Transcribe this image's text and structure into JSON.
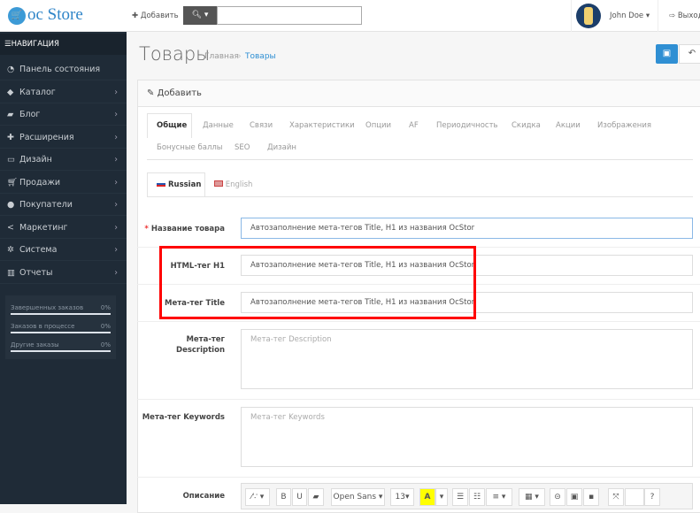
{
  "header": {
    "logo_text": "oc Store",
    "add_label": "Добавить",
    "search_placeholder": "",
    "user_name": "John Doe",
    "logout_label": "Выход"
  },
  "sidebar": {
    "nav_title": "НАВИГАЦИЯ",
    "items": [
      {
        "label": "Панель состояния",
        "icon": "dashboard-icon",
        "arrow": false
      },
      {
        "label": "Каталог",
        "icon": "tag-icon",
        "arrow": true
      },
      {
        "label": "Блог",
        "icon": "book-icon",
        "arrow": true
      },
      {
        "label": "Расширения",
        "icon": "puzzle-icon",
        "arrow": true
      },
      {
        "label": "Дизайн",
        "icon": "monitor-icon",
        "arrow": true
      },
      {
        "label": "Продажи",
        "icon": "cart-icon",
        "arrow": true
      },
      {
        "label": "Покупатели",
        "icon": "user-icon",
        "arrow": true
      },
      {
        "label": "Маркетинг",
        "icon": "share-icon",
        "arrow": true
      },
      {
        "label": "Система",
        "icon": "gear-icon",
        "arrow": true
      },
      {
        "label": "Отчеты",
        "icon": "bar-chart-icon",
        "arrow": true
      }
    ],
    "stats": [
      {
        "label": "Завершенных заказов",
        "value": "0%"
      },
      {
        "label": "Заказов в процессе",
        "value": "0%"
      },
      {
        "label": "Другие заказы",
        "value": "0%"
      }
    ]
  },
  "page": {
    "title": "Товары",
    "breadcrumb": [
      "Главная",
      "Товары"
    ],
    "panel_title": "Добавить"
  },
  "tabs": [
    "Общие",
    "Данные",
    "Связи",
    "Характеристики",
    "Опции",
    "AF",
    "Периодичность",
    "Скидка",
    "Акции",
    "Изображения",
    "Бонусные баллы",
    "SEO",
    "Дизайн"
  ],
  "languages": [
    "Russian",
    "English"
  ],
  "form": {
    "name_label": "Название товара",
    "name_value": "Автозаполнение мета-тегов Title, H1 из названия OcStor",
    "h1_label": "HTML-тег H1",
    "h1_value": "Автозаполнение мета-тегов Title, H1 из названия OcStor",
    "title_label": "Мета-тег Title",
    "title_value": "Автозаполнение мета-тегов Title, H1 из названия OcStor",
    "desc_label_1": "Мета-тег",
    "desc_label_2": "Description",
    "desc_placeholder": "Мета-тег Description",
    "kw_label": "Мета-тег Keywords",
    "kw_placeholder": "Мета-тег Keywords",
    "description_label": "Описание"
  },
  "editor": {
    "font": "Open Sans",
    "size": "13"
  },
  "colors": {
    "sidebar": "#1f2b37",
    "accent": "#2f8fd3",
    "highlight": "#ff0000"
  }
}
